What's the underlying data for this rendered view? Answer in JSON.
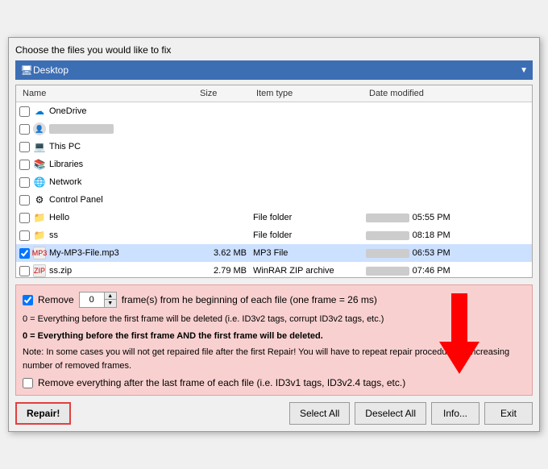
{
  "dialog": {
    "title": "Choose the files you would like to fix",
    "path": "Desktop",
    "path_icon": "🖥"
  },
  "columns": {
    "name": "Name",
    "size": "Size",
    "item_type": "Item type",
    "date_modified": "Date modified"
  },
  "files": [
    {
      "id": "onedrive",
      "name": "OneDrive",
      "icon": "☁",
      "icon_class": "icon-onedrive",
      "size": "",
      "type": "",
      "date": "",
      "checked": false
    },
    {
      "id": "user",
      "name": "",
      "icon": "👤",
      "icon_class": "icon-person",
      "size": "",
      "type": "",
      "date": "",
      "checked": false,
      "blurred_name": true
    },
    {
      "id": "thispc",
      "name": "This PC",
      "icon": "💻",
      "icon_class": "icon-pc",
      "size": "",
      "type": "",
      "date": "",
      "checked": false
    },
    {
      "id": "libraries",
      "name": "Libraries",
      "icon": "📁",
      "icon_class": "icon-library",
      "size": "",
      "type": "",
      "date": "",
      "checked": false
    },
    {
      "id": "network",
      "name": "Network",
      "icon": "🌐",
      "icon_class": "icon-network",
      "size": "",
      "type": "",
      "date": "",
      "checked": false
    },
    {
      "id": "controlpanel",
      "name": "Control Panel",
      "icon": "⚙",
      "icon_class": "icon-control",
      "size": "",
      "type": "",
      "date": "",
      "checked": false
    },
    {
      "id": "hello",
      "name": "Hello",
      "icon": "📂",
      "icon_class": "icon-folder-yellow",
      "size": "",
      "type": "File folder",
      "date": "05:55 PM",
      "date_blurred": true,
      "checked": false
    },
    {
      "id": "ss",
      "name": "ss",
      "icon": "📂",
      "icon_class": "icon-folder-yellow",
      "size": "",
      "type": "File folder",
      "date": "08:18 PM",
      "date_blurred": true,
      "checked": false
    },
    {
      "id": "mp3",
      "name": "My-MP3-File.mp3",
      "icon": "🎵",
      "icon_class": "icon-mp3",
      "size": "3.62 MB",
      "type": "MP3 File",
      "date": "06:53 PM",
      "date_blurred": true,
      "checked": true
    },
    {
      "id": "zip",
      "name": "ss.zip",
      "icon": "🗜",
      "icon_class": "icon-zip",
      "size": "2.79 MB",
      "type": "WinRAR ZIP archive",
      "date": "07:46 PM",
      "date_blurred": true,
      "checked": false
    }
  ],
  "bottom": {
    "remove_label": "Remove",
    "remove_value": "0",
    "remove_description": "frame(s) from he beginning of each file (one frame = 26 ms)",
    "info1": "0 = Everything before the first frame will be deleted (i.e. ID3v2 tags, corrupt ID3v2 tags, etc.)",
    "info2": "0 = Everything before the first frame AND the first frame will be deleted.",
    "info3": "Note: In some cases you will not get repaired file after the first Repair! You will have to repeat repair procedure by increasing number of removed frames.",
    "remove_after_label": "Remove everything after the last frame of each file (i.e. ID3v1 tags, ID3v2.4 tags, etc.)"
  },
  "buttons": {
    "repair": "Repair!",
    "select_all": "Select All",
    "deselect_all": "Deselect All",
    "info": "Info...",
    "exit": "Exit"
  }
}
